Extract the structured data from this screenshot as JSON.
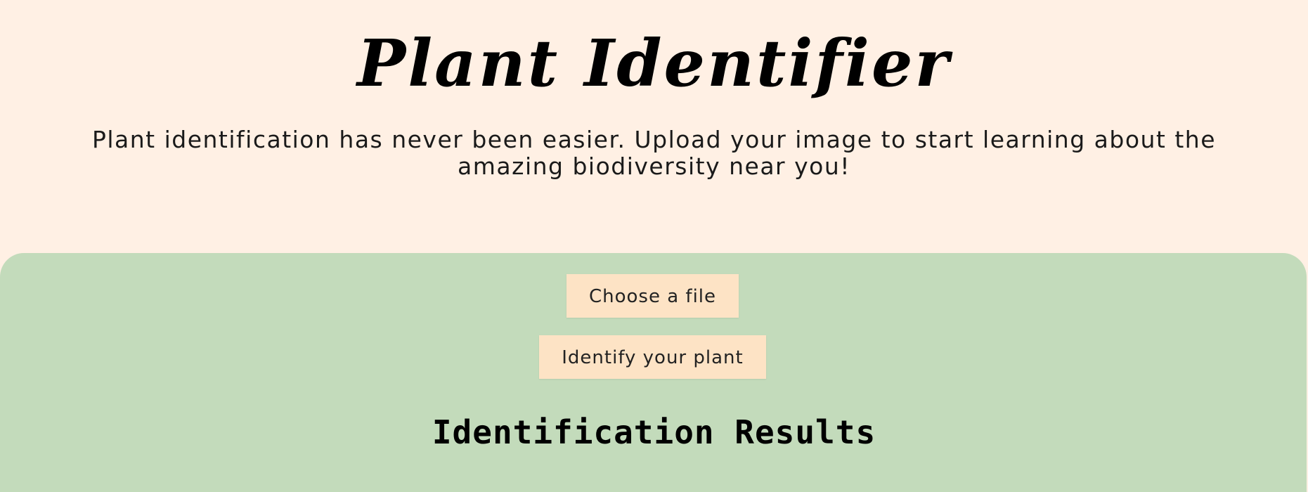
{
  "header": {
    "title": "Plant Identifier",
    "subtitle": "Plant identification has never been easier. Upload your image to start learning about the amazing biodiversity near you!"
  },
  "upload": {
    "choose_file_label": "Choose a file",
    "identify_label": "Identify your plant"
  },
  "results": {
    "heading": "Identification Results"
  },
  "colors": {
    "page_background": "#fff0e4",
    "panel_background": "#c3dbbb",
    "button_background": "#fde3c5"
  }
}
